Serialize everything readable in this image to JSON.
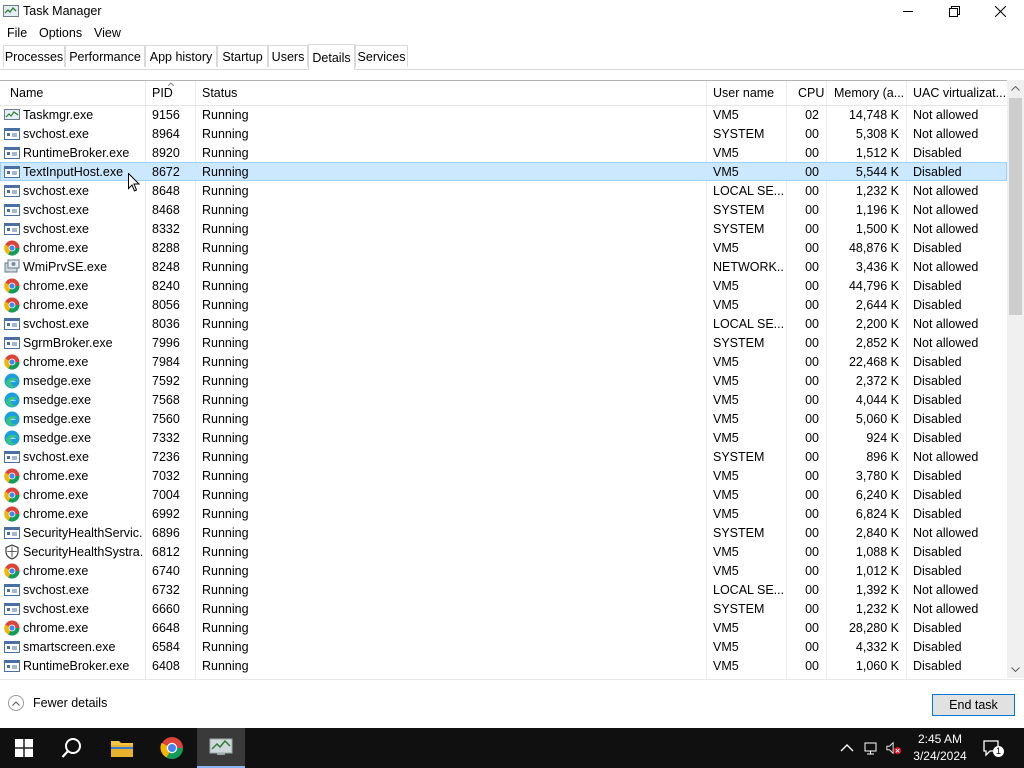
{
  "window": {
    "title": "Task Manager"
  },
  "menu": [
    "File",
    "Options",
    "View"
  ],
  "tabs": [
    "Processes",
    "Performance",
    "App history",
    "Startup",
    "Users",
    "Details",
    "Services"
  ],
  "active_tab": "Details",
  "columns": {
    "name": "Name",
    "pid": "PID",
    "status": "Status",
    "user": "User name",
    "cpu": "CPU",
    "mem": "Memory (a...",
    "uac": "UAC virtualizat..."
  },
  "rows": [
    {
      "icon": "taskmgr-icon",
      "name": "Taskmgr.exe",
      "pid": "9156",
      "status": "Running",
      "user": "VM5",
      "cpu": "02",
      "mem": "14,748 K",
      "uac": "Not allowed"
    },
    {
      "icon": "service-host-icon",
      "name": "svchost.exe",
      "pid": "8964",
      "status": "Running",
      "user": "SYSTEM",
      "cpu": "00",
      "mem": "5,308 K",
      "uac": "Not allowed"
    },
    {
      "icon": "service-host-icon",
      "name": "RuntimeBroker.exe",
      "pid": "8920",
      "status": "Running",
      "user": "VM5",
      "cpu": "00",
      "mem": "1,512 K",
      "uac": "Disabled"
    },
    {
      "icon": "service-host-icon",
      "name": "TextInputHost.exe",
      "pid": "8672",
      "status": "Running",
      "user": "VM5",
      "cpu": "00",
      "mem": "5,544 K",
      "uac": "Disabled",
      "selected": true
    },
    {
      "icon": "service-host-icon",
      "name": "svchost.exe",
      "pid": "8648",
      "status": "Running",
      "user": "LOCAL SE...",
      "cpu": "00",
      "mem": "1,232 K",
      "uac": "Not allowed"
    },
    {
      "icon": "service-host-icon",
      "name": "svchost.exe",
      "pid": "8468",
      "status": "Running",
      "user": "SYSTEM",
      "cpu": "00",
      "mem": "1,196 K",
      "uac": "Not allowed"
    },
    {
      "icon": "service-host-icon",
      "name": "svchost.exe",
      "pid": "8332",
      "status": "Running",
      "user": "SYSTEM",
      "cpu": "00",
      "mem": "1,500 K",
      "uac": "Not allowed"
    },
    {
      "icon": "chrome-icon",
      "name": "chrome.exe",
      "pid": "8288",
      "status": "Running",
      "user": "VM5",
      "cpu": "00",
      "mem": "48,876 K",
      "uac": "Disabled"
    },
    {
      "icon": "wmi-icon",
      "name": "WmiPrvSE.exe",
      "pid": "8248",
      "status": "Running",
      "user": "NETWORK...",
      "cpu": "00",
      "mem": "3,436 K",
      "uac": "Not allowed"
    },
    {
      "icon": "chrome-icon",
      "name": "chrome.exe",
      "pid": "8240",
      "status": "Running",
      "user": "VM5",
      "cpu": "00",
      "mem": "44,796 K",
      "uac": "Disabled"
    },
    {
      "icon": "chrome-icon",
      "name": "chrome.exe",
      "pid": "8056",
      "status": "Running",
      "user": "VM5",
      "cpu": "00",
      "mem": "2,644 K",
      "uac": "Disabled"
    },
    {
      "icon": "service-host-icon",
      "name": "svchost.exe",
      "pid": "8036",
      "status": "Running",
      "user": "LOCAL SE...",
      "cpu": "00",
      "mem": "2,200 K",
      "uac": "Not allowed"
    },
    {
      "icon": "service-host-icon",
      "name": "SgrmBroker.exe",
      "pid": "7996",
      "status": "Running",
      "user": "SYSTEM",
      "cpu": "00",
      "mem": "2,852 K",
      "uac": "Not allowed"
    },
    {
      "icon": "chrome-icon",
      "name": "chrome.exe",
      "pid": "7984",
      "status": "Running",
      "user": "VM5",
      "cpu": "00",
      "mem": "22,468 K",
      "uac": "Disabled"
    },
    {
      "icon": "edge-icon",
      "name": "msedge.exe",
      "pid": "7592",
      "status": "Running",
      "user": "VM5",
      "cpu": "00",
      "mem": "2,372 K",
      "uac": "Disabled"
    },
    {
      "icon": "edge-icon",
      "name": "msedge.exe",
      "pid": "7568",
      "status": "Running",
      "user": "VM5",
      "cpu": "00",
      "mem": "4,044 K",
      "uac": "Disabled"
    },
    {
      "icon": "edge-icon",
      "name": "msedge.exe",
      "pid": "7560",
      "status": "Running",
      "user": "VM5",
      "cpu": "00",
      "mem": "5,060 K",
      "uac": "Disabled"
    },
    {
      "icon": "edge-icon",
      "name": "msedge.exe",
      "pid": "7332",
      "status": "Running",
      "user": "VM5",
      "cpu": "00",
      "mem": "924 K",
      "uac": "Disabled"
    },
    {
      "icon": "service-host-icon",
      "name": "svchost.exe",
      "pid": "7236",
      "status": "Running",
      "user": "SYSTEM",
      "cpu": "00",
      "mem": "896 K",
      "uac": "Not allowed"
    },
    {
      "icon": "chrome-icon",
      "name": "chrome.exe",
      "pid": "7032",
      "status": "Running",
      "user": "VM5",
      "cpu": "00",
      "mem": "3,780 K",
      "uac": "Disabled"
    },
    {
      "icon": "chrome-icon",
      "name": "chrome.exe",
      "pid": "7004",
      "status": "Running",
      "user": "VM5",
      "cpu": "00",
      "mem": "6,240 K",
      "uac": "Disabled"
    },
    {
      "icon": "chrome-icon",
      "name": "chrome.exe",
      "pid": "6992",
      "status": "Running",
      "user": "VM5",
      "cpu": "00",
      "mem": "6,824 K",
      "uac": "Disabled"
    },
    {
      "icon": "service-host-icon",
      "name": "SecurityHealthServic...",
      "pid": "6896",
      "status": "Running",
      "user": "SYSTEM",
      "cpu": "00",
      "mem": "2,840 K",
      "uac": "Not allowed"
    },
    {
      "icon": "shield-icon",
      "name": "SecurityHealthSystra...",
      "pid": "6812",
      "status": "Running",
      "user": "VM5",
      "cpu": "00",
      "mem": "1,088 K",
      "uac": "Disabled"
    },
    {
      "icon": "chrome-icon",
      "name": "chrome.exe",
      "pid": "6740",
      "status": "Running",
      "user": "VM5",
      "cpu": "00",
      "mem": "1,012 K",
      "uac": "Disabled"
    },
    {
      "icon": "service-host-icon",
      "name": "svchost.exe",
      "pid": "6732",
      "status": "Running",
      "user": "LOCAL SE...",
      "cpu": "00",
      "mem": "1,392 K",
      "uac": "Not allowed"
    },
    {
      "icon": "service-host-icon",
      "name": "svchost.exe",
      "pid": "6660",
      "status": "Running",
      "user": "SYSTEM",
      "cpu": "00",
      "mem": "1,232 K",
      "uac": "Not allowed"
    },
    {
      "icon": "chrome-icon",
      "name": "chrome.exe",
      "pid": "6648",
      "status": "Running",
      "user": "VM5",
      "cpu": "00",
      "mem": "28,280 K",
      "uac": "Disabled"
    },
    {
      "icon": "service-host-icon",
      "name": "smartscreen.exe",
      "pid": "6584",
      "status": "Running",
      "user": "VM5",
      "cpu": "00",
      "mem": "4,332 K",
      "uac": "Disabled"
    },
    {
      "icon": "service-host-icon",
      "name": "RuntimeBroker.exe",
      "pid": "6408",
      "status": "Running",
      "user": "VM5",
      "cpu": "00",
      "mem": "1,060 K",
      "uac": "Disabled"
    }
  ],
  "bottom": {
    "fewer_details": "Fewer details",
    "end_task": "End task"
  },
  "clock": {
    "time": "2:45 AM",
    "date": "3/24/2024"
  },
  "notifications_count": "1",
  "colors": {
    "selection": "#cce8ff",
    "accent": "#0078d7",
    "taskbar": "#101010"
  }
}
